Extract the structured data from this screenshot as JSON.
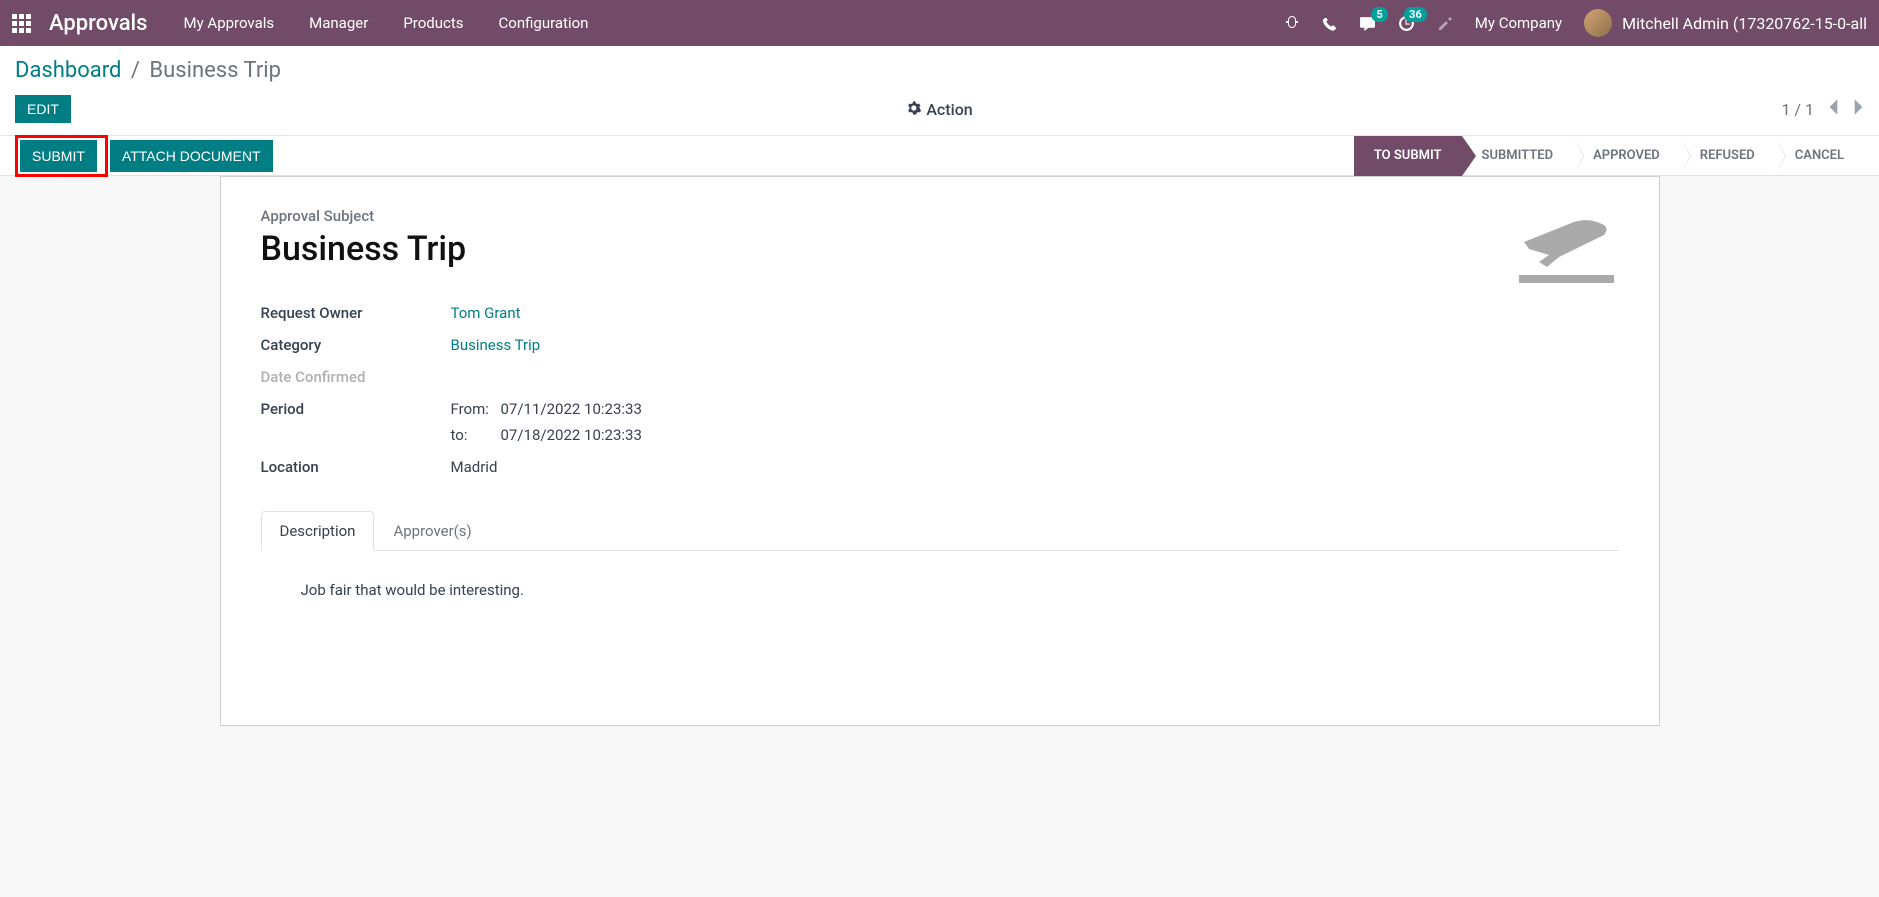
{
  "topbar": {
    "app_title": "Approvals",
    "nav": [
      "My Approvals",
      "Manager",
      "Products",
      "Configuration"
    ],
    "chat_badge": "5",
    "activity_badge": "36",
    "company": "My Company",
    "user": "Mitchell Admin (17320762-15-0-all"
  },
  "breadcrumb": {
    "root": "Dashboard",
    "current": "Business Trip"
  },
  "toolbar": {
    "edit": "Edit",
    "action": "Action",
    "pager": "1 / 1"
  },
  "statusbar": {
    "submit": "Submit",
    "attach": "Attach Document",
    "steps": [
      "To Submit",
      "Submitted",
      "Approved",
      "Refused",
      "Cancel"
    ],
    "active_step": 0
  },
  "form": {
    "subject_label": "Approval Subject",
    "subject": "Business Trip",
    "labels": {
      "owner": "Request Owner",
      "category": "Category",
      "date_confirmed": "Date Confirmed",
      "period": "Period",
      "location": "Location"
    },
    "owner": "Tom Grant",
    "category": "Business Trip",
    "period_from_label": "From:",
    "period_from": "07/11/2022 10:23:33",
    "period_to_label": "to:",
    "period_to": "07/18/2022 10:23:33",
    "location": "Madrid"
  },
  "tabs": {
    "description": "Description",
    "approvers": "Approver(s)"
  },
  "description_text": "Job fair that would be interesting."
}
